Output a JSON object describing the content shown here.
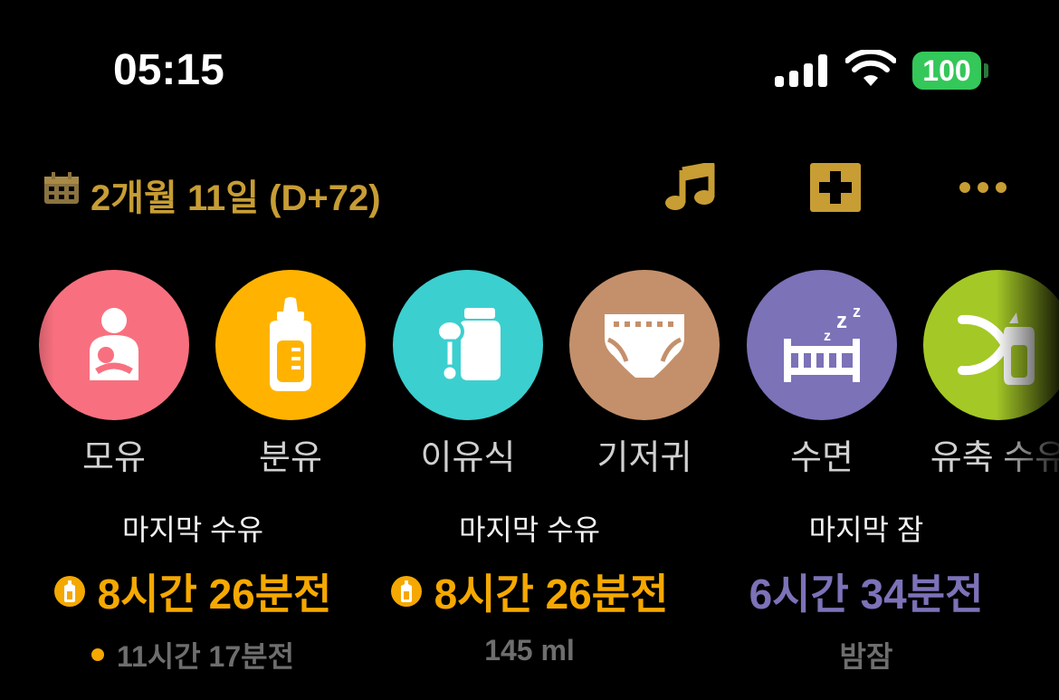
{
  "status": {
    "time": "05:15",
    "battery": "100"
  },
  "header": {
    "date": "2개월 11일 (D+72)",
    "accent_color": "#c79d34",
    "icons": [
      "calendar-icon",
      "music-note-icon",
      "plus-box-icon",
      "more-icon"
    ]
  },
  "categories": [
    {
      "label": "모유",
      "color": "#f8707f",
      "icon": "breastfeeding-icon"
    },
    {
      "label": "분유",
      "color": "#ffb300",
      "icon": "baby-bottle-icon"
    },
    {
      "label": "이유식",
      "color": "#3ccfcf",
      "icon": "baby-food-icon"
    },
    {
      "label": "기저귀",
      "color": "#c4906b",
      "icon": "diaper-icon"
    },
    {
      "label": "수면",
      "color": "#7b72b8",
      "icon": "crib-sleep-icon"
    },
    {
      "label": "유축 수유",
      "color": "#a4c926",
      "icon": "pump-feeding-icon"
    }
  ],
  "summary": [
    {
      "title": "마지막 수유",
      "value": "8시간 26분전",
      "sub": "11시간 17분전",
      "value_color": "#f5a800"
    },
    {
      "title": "마지막 수유",
      "value": "8시간 26분전",
      "sub": "145 ml",
      "value_color": "#f5a800"
    },
    {
      "title": "마지막 잠",
      "value": "6시간 34분전",
      "sub": "밤잠",
      "value_color": "#7b72b8"
    }
  ]
}
